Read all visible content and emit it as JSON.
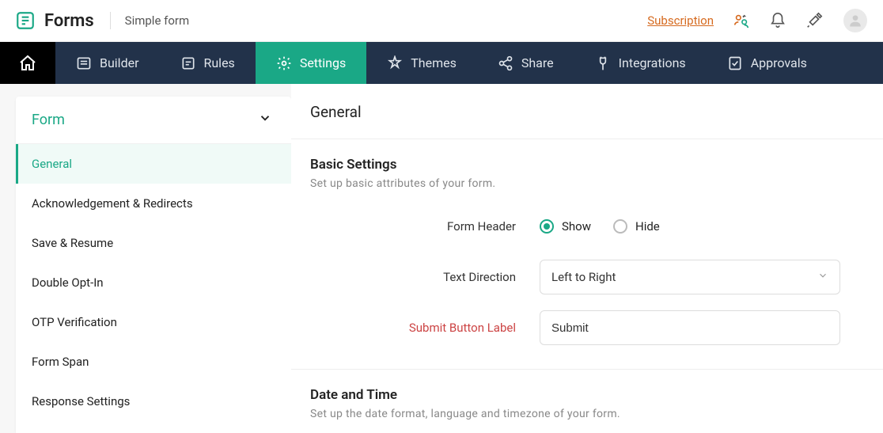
{
  "header": {
    "brand": "Forms",
    "form_title": "Simple form",
    "subscription_link": "Subscription"
  },
  "nav": {
    "items": [
      {
        "id": "builder",
        "label": "Builder"
      },
      {
        "id": "rules",
        "label": "Rules"
      },
      {
        "id": "settings",
        "label": "Settings"
      },
      {
        "id": "themes",
        "label": "Themes"
      },
      {
        "id": "share",
        "label": "Share"
      },
      {
        "id": "integrations",
        "label": "Integrations"
      },
      {
        "id": "approvals",
        "label": "Approvals"
      }
    ]
  },
  "sidebar": {
    "group_label": "Form",
    "items": [
      {
        "label": "General"
      },
      {
        "label": "Acknowledgement & Redirects"
      },
      {
        "label": "Save & Resume"
      },
      {
        "label": "Double Opt-In"
      },
      {
        "label": "OTP Verification"
      },
      {
        "label": "Form Span"
      },
      {
        "label": "Response Settings"
      }
    ]
  },
  "main": {
    "page_title": "General",
    "basic": {
      "title": "Basic Settings",
      "desc": "Set up basic attributes of your form.",
      "form_header_label": "Form Header",
      "form_header_options": {
        "show": "Show",
        "hide": "Hide"
      },
      "form_header_selected": "show",
      "text_direction_label": "Text Direction",
      "text_direction_value": "Left to Right",
      "submit_label_label": "Submit Button Label",
      "submit_label_value": "Submit"
    },
    "datetime": {
      "title": "Date and Time",
      "desc": "Set up the date format, language and timezone of your form."
    }
  }
}
